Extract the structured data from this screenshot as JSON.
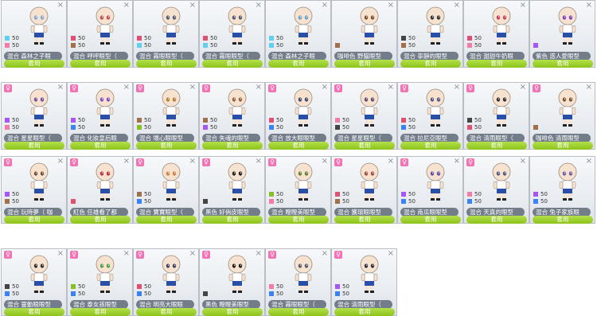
{
  "ui": {
    "close_glyph": "×",
    "gender_glyph": "♀",
    "apply_label": "套用"
  },
  "colors": {
    "cyan": "#5fd0f0",
    "pink": "#f47aa8",
    "red": "#e05070",
    "blue": "#3b82f6",
    "brown": "#a0704a",
    "dark": "#444444",
    "purple": "#a855f7",
    "green": "#86c024",
    "yellow": "#f0c020"
  },
  "cards": [
    {
      "name": "混合 森林之子眼",
      "swatches": [
        {
          "color": "cyan",
          "pct": "50"
        },
        {
          "color": "pink",
          "pct": "50"
        }
      ],
      "eye": "#7aa8d8",
      "gender": false
    },
    {
      "name": "混合 呼呼眼型（",
      "swatches": [
        {
          "color": "red",
          "pct": "50"
        },
        {
          "color": "brown",
          "pct": "50"
        }
      ],
      "eye": "#c05050",
      "gender": false
    },
    {
      "name": "混合 霧眼眼型（",
      "swatches": [
        {
          "color": "red",
          "pct": "50"
        },
        {
          "color": "cyan",
          "pct": "50"
        }
      ],
      "eye": "#505a70",
      "gender": false
    },
    {
      "name": "混合 霧眼眼型（",
      "swatches": [
        {
          "color": "red",
          "pct": "50"
        },
        {
          "color": "cyan",
          "pct": "50"
        }
      ],
      "eye": "#505a70",
      "gender": false
    },
    {
      "name": "混合 森林之子眼",
      "swatches": [
        {
          "color": "cyan",
          "pct": "50"
        },
        {
          "color": "cyan",
          "pct": "50"
        }
      ],
      "eye": "#6aa0d0",
      "gender": false
    },
    {
      "name": "咖啡色 野貓眼型",
      "swatches": [
        {
          "color": "brown",
          "pct": ""
        }
      ],
      "eye": "#7a5030",
      "gender": false
    },
    {
      "name": "混合 寧靜的眼型",
      "swatches": [
        {
          "color": "dark",
          "pct": "50"
        },
        {
          "color": "brown",
          "pct": "50"
        }
      ],
      "eye": "#333333",
      "gender": false
    },
    {
      "name": "混合 甜甜牛奶眼",
      "swatches": [
        {
          "color": "red",
          "pct": "50"
        },
        {
          "color": "pink",
          "pct": "50"
        }
      ],
      "eye": "#c04060",
      "gender": false
    },
    {
      "name": "紫色 惑人愛眼型",
      "swatches": [
        {
          "color": "purple",
          "pct": ""
        }
      ],
      "eye": "#8040c0",
      "gender": false
    },
    {
      "name": "混合 星星眼型（",
      "swatches": [
        {
          "color": "purple",
          "pct": "50"
        },
        {
          "color": "pink",
          "pct": "50"
        }
      ],
      "eye": "#7050a0",
      "gender": true
    },
    {
      "name": "混合 化妝皇后眼",
      "swatches": [
        {
          "color": "purple",
          "pct": "50"
        },
        {
          "color": "blue",
          "pct": "50"
        }
      ],
      "eye": "#8050c0",
      "gender": true
    },
    {
      "name": "混合 壞心眼眼型",
      "swatches": [
        {
          "color": "brown",
          "pct": "50"
        },
        {
          "color": "green",
          "pct": "50"
        }
      ],
      "eye": "#b08030",
      "gender": true
    },
    {
      "name": "混合 失魂的眼型",
      "swatches": [
        {
          "color": "brown",
          "pct": "50"
        },
        {
          "color": "purple",
          "pct": "50"
        }
      ],
      "eye": "#906040",
      "gender": true
    },
    {
      "name": "混合 放大眼眼型",
      "swatches": [
        {
          "color": "red",
          "pct": "50"
        },
        {
          "color": "blue",
          "pct": "50"
        }
      ],
      "eye": "#404870",
      "gender": true
    },
    {
      "name": "混合 星星眼型（",
      "swatches": [
        {
          "color": "pink",
          "pct": "50"
        },
        {
          "color": "dark",
          "pct": "50"
        }
      ],
      "eye": "#604a70",
      "gender": true
    },
    {
      "name": "混合 拉尼亞眼型",
      "swatches": [
        {
          "color": "red",
          "pct": "50"
        },
        {
          "color": "blue",
          "pct": "50"
        }
      ],
      "eye": "#505880",
      "gender": true
    },
    {
      "name": "混合 清雨眼型（",
      "swatches": [
        {
          "color": "dark",
          "pct": "50"
        },
        {
          "color": "red",
          "pct": "50"
        }
      ],
      "eye": "#303030",
      "gender": true
    },
    {
      "name": "咖啡色 清雨眼型",
      "swatches": [
        {
          "color": "brown",
          "pct": ""
        }
      ],
      "eye": "#7a5030",
      "gender": true
    },
    {
      "name": "混合 玩時夢（ 咖",
      "swatches": [
        {
          "color": "purple",
          "pct": "50"
        },
        {
          "color": "brown",
          "pct": "50"
        }
      ],
      "eye": "#705040",
      "gender": true
    },
    {
      "name": "紅色 任雄看了都",
      "swatches": [
        {
          "color": "red",
          "pct": ""
        }
      ],
      "eye": "#c03040",
      "gender": true
    },
    {
      "name": "混合 寶寶眼型（",
      "swatches": [
        {
          "color": "brown",
          "pct": "50"
        },
        {
          "color": "blue",
          "pct": "50"
        }
      ],
      "eye": "#d08040",
      "gender": true
    },
    {
      "name": "黑色 好俏皮眼型",
      "swatches": [
        {
          "color": "dark",
          "pct": ""
        }
      ],
      "eye": "#222222",
      "gender": true
    },
    {
      "name": "混合 瞪瞪美眼型",
      "swatches": [
        {
          "color": "green",
          "pct": "50"
        },
        {
          "color": "pink",
          "pct": "50"
        }
      ],
      "eye": "#608030",
      "gender": true
    },
    {
      "name": "混合 獲環眼眼型",
      "swatches": [
        {
          "color": "red",
          "pct": "50"
        },
        {
          "color": "brown",
          "pct": "50"
        }
      ],
      "eye": "#a05040",
      "gender": true
    },
    {
      "name": "混合 南瓜眼眼型",
      "swatches": [
        {
          "color": "purple",
          "pct": "50"
        },
        {
          "color": "blue",
          "pct": "50"
        }
      ],
      "eye": "#6050a0",
      "gender": true
    },
    {
      "name": "混合 天真的眼型",
      "swatches": [
        {
          "color": "pink",
          "pct": "50"
        },
        {
          "color": "blue",
          "pct": "50"
        }
      ],
      "eye": "#505a80",
      "gender": true
    },
    {
      "name": "混合 兔子家族眼",
      "swatches": [
        {
          "color": "purple",
          "pct": "50"
        },
        {
          "color": "blue",
          "pct": "50"
        }
      ],
      "eye": "#6a60a0",
      "gender": false
    },
    {
      "name": "混合 靈動眼眼型",
      "swatches": [
        {
          "color": "dark",
          "pct": "50"
        },
        {
          "color": "blue",
          "pct": "50"
        }
      ],
      "eye": "#303030",
      "gender": true
    },
    {
      "name": "混合 泰女孩眼型",
      "swatches": [
        {
          "color": "green",
          "pct": "50"
        },
        {
          "color": "blue",
          "pct": "50"
        }
      ],
      "eye": "#50a050",
      "gender": true
    },
    {
      "name": "混合 明亮大眼眼",
      "swatches": [
        {
          "color": "red",
          "pct": "50"
        },
        {
          "color": "blue",
          "pct": "50"
        }
      ],
      "eye": "#404060",
      "gender": true
    },
    {
      "name": "黑色 瞪瞪美眼型",
      "swatches": [
        {
          "color": "dark",
          "pct": ""
        }
      ],
      "eye": "#222222",
      "gender": true
    },
    {
      "name": "混合 霧眼眼型（",
      "swatches": [
        {
          "color": "pink",
          "pct": "50"
        },
        {
          "color": "blue",
          "pct": "50"
        }
      ],
      "eye": "#505a70",
      "gender": true
    },
    {
      "name": "混合 清雨眼型（",
      "swatches": [
        {
          "color": "purple",
          "pct": "50"
        },
        {
          "color": "blue",
          "pct": "50"
        }
      ],
      "eye": "#303040",
      "gender": true
    }
  ]
}
